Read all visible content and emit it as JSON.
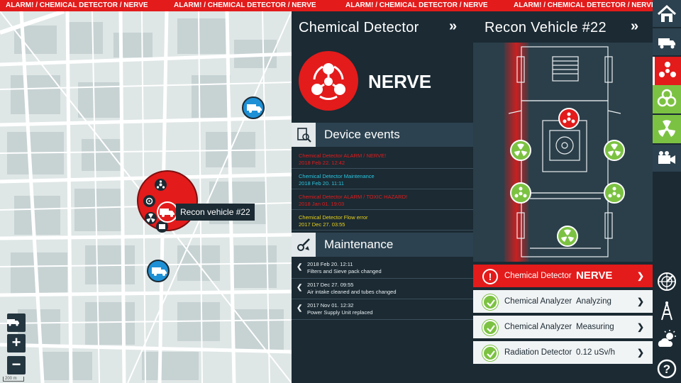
{
  "alarm_bar": {
    "left_text": "ALARM! / CHEMICAL DETECTOR / NERVE",
    "mid_text": "ALARM! / CHEMICAL DETECTOR / NERVE",
    "mid2_text": "ALARM! / CHEMICAL DETECTOR / NERVE",
    "right_text": "ALARM! / CHEMICAL DETECTOR / NERVE"
  },
  "map": {
    "scale_label": "200 m",
    "recon_label": "Recon vehicle #22",
    "zoom_in": "+",
    "zoom_out": "−"
  },
  "chemical_detector": {
    "title": "Chemical Detector",
    "expand_glyph": "»",
    "agent": "NERVE",
    "device_events_title": "Device events",
    "events": [
      {
        "line1": "Chemical Detector  ALARM / NERVE!",
        "line2": "2018 Feb 22. 12:42",
        "color": "#e31b1b"
      },
      {
        "line1": "Chemical Detector  Maintenance",
        "line2": "2018 Feb 20. 11:11",
        "color": "#2bc6e0"
      },
      {
        "line1": "Chemical Detector  ALARM / TOXIC HAZARD!",
        "line2": "2018 Jan 01. 19:03",
        "color": "#e31b1b"
      },
      {
        "line1": "Chemical Detector  Flow error",
        "line2": "2017 Dec 27. 03:55",
        "color": "#e8d21d"
      }
    ],
    "maintenance_title": "Maintenance",
    "maintenance": [
      {
        "line1": "2018 Feb 20. 12:11",
        "line2": "Filters and Sieve pack changed"
      },
      {
        "line1": "2017 Dec 27. 09:55",
        "line2": "Air intake cleaned and tubes changed"
      },
      {
        "line1": "2017 Nov 01. 12:32",
        "line2": "Power Supply Unit replaced"
      }
    ],
    "maint_chevron": "❮"
  },
  "recon_vehicle": {
    "title": "Recon Vehicle #22",
    "expand_glyph": "»",
    "status_rows": [
      {
        "name": "Chemical Detector",
        "value": "NERVE",
        "state": "alarm",
        "icon": "warning-icon",
        "glyph": "!"
      },
      {
        "name": "Chemical Analyzer",
        "value": "Analyzing",
        "state": "ok",
        "icon": "check-icon"
      },
      {
        "name": "Chemical Analyzer",
        "value": "Measuring",
        "state": "ok",
        "icon": "check-icon"
      },
      {
        "name": "Radiation Detector",
        "value": "0.12 uSv/h",
        "state": "ok",
        "icon": "check-icon"
      }
    ],
    "row_chevron": "❯"
  },
  "colors": {
    "alarm_red": "#e31b1b",
    "ok_green": "#7cc242",
    "panel_dark": "#1b2a33",
    "vehicle_blue": "#1e90d6"
  },
  "sidebar": {
    "items": [
      "home-icon",
      "vehicle-icon",
      "chemical-icon",
      "biohazard-icon",
      "radiation-icon",
      "camera-icon",
      "radar-icon",
      "antenna-icon",
      "weather-icon",
      "help-icon"
    ]
  }
}
